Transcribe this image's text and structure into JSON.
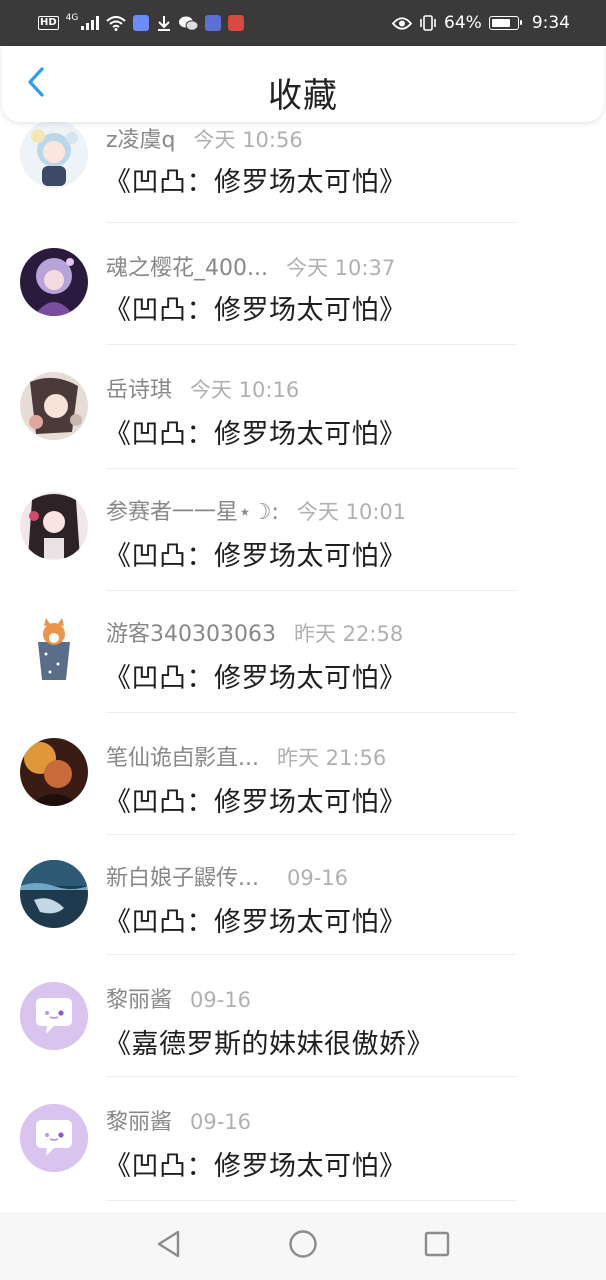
{
  "status_bar": {
    "network": "4G",
    "battery": "64%",
    "battery_level": 0.64,
    "time": "9:34",
    "icons": [
      "hd-icon",
      "signal-icon",
      "wifi-icon",
      "music-app-icon",
      "download-icon",
      "wechat-icon",
      "app-icon",
      "game-app-icon",
      "eye-icon",
      "vibrate-icon",
      "battery-icon"
    ]
  },
  "header": {
    "title": "收藏",
    "back_icon": "chevron-left-icon"
  },
  "colors": {
    "accent": "#2f9cf4",
    "status_bar_bg": "#3a3a3a",
    "placeholder_avatar": "#d9c4f0"
  },
  "items": [
    {
      "user": "z凌虞q",
      "time": "今天 10:56",
      "book": "《凹凸：修罗场太可怕》",
      "avatar": "avatar-anime-girl-blue-hair"
    },
    {
      "user": "魂之樱花_400...",
      "time": "今天 10:37",
      "book": "《凹凸：修罗场太可怕》",
      "avatar": "avatar-anime-girl-purple"
    },
    {
      "user": "岳诗琪",
      "time": "今天 10:16",
      "book": "《凹凸：修罗场太可怕》",
      "avatar": "avatar-girl-with-flowers"
    },
    {
      "user": "参赛者一一星⋆☽:",
      "time": "今天 10:01",
      "book": "《凹凸：修罗场太可怕》",
      "avatar": "avatar-anime-girl-dark-hair"
    },
    {
      "user": "游客340303063",
      "time": "昨天 22:58",
      "book": "《凹凸：修罗场太可怕》",
      "avatar": "avatar-cat-in-cup"
    },
    {
      "user": "笔仙诡卣影直...",
      "time": "昨天 21:56",
      "book": "《凹凸：修罗场太可怕》",
      "avatar": "avatar-dark-portrait"
    },
    {
      "user": "新白娘子鼹传...",
      "time": "09-16",
      "book": "《凹凸：修罗场太可怕》",
      "avatar": "avatar-underwater"
    },
    {
      "user": "黎丽酱",
      "time": "09-16",
      "book": "《嘉德罗斯的妹妹很傲娇》",
      "avatar": "avatar-default-chat"
    },
    {
      "user": "黎丽酱",
      "time": "09-16",
      "book": "《凹凸：修罗场太可怕》",
      "avatar": "avatar-default-chat"
    }
  ],
  "nav": {
    "icons": [
      "back-triangle-icon",
      "home-circle-icon",
      "recents-square-icon"
    ]
  }
}
